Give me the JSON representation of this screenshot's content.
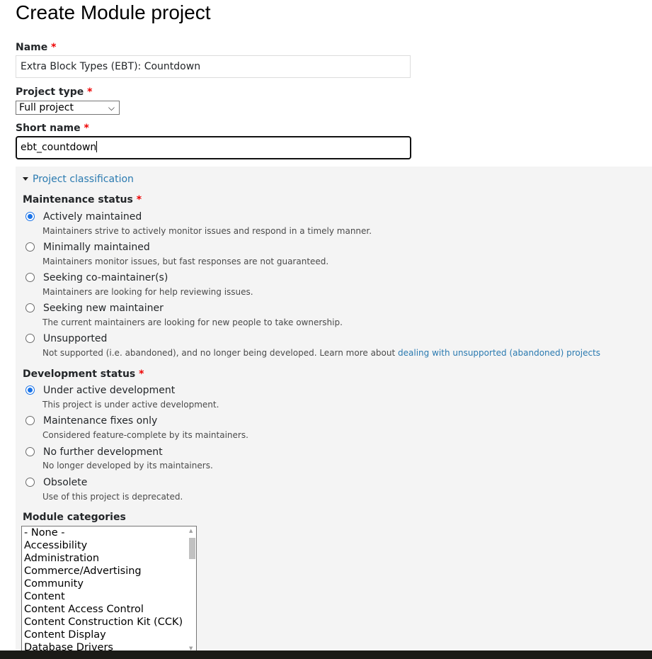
{
  "page": {
    "title": "Create Module project"
  },
  "form": {
    "name": {
      "label": "Name",
      "required_marker": "*",
      "value": "Extra Block Types (EBT): Countdown"
    },
    "project_type": {
      "label": "Project type",
      "required_marker": "*",
      "selected": "Full project"
    },
    "short_name": {
      "label": "Short name",
      "required_marker": "*",
      "value": "ebt_countdown"
    }
  },
  "classification": {
    "legend": "Project classification",
    "maintenance": {
      "label": "Maintenance status",
      "required_marker": "*",
      "options": [
        {
          "label": "Actively maintained",
          "desc": "Maintainers strive to actively monitor issues and respond in a timely manner.",
          "checked": true
        },
        {
          "label": "Minimally maintained",
          "desc": "Maintainers monitor issues, but fast responses are not guaranteed.",
          "checked": false
        },
        {
          "label": "Seeking co-maintainer(s)",
          "desc": "Maintainers are looking for help reviewing issues.",
          "checked": false
        },
        {
          "label": "Seeking new maintainer",
          "desc": "The current maintainers are looking for new people to take ownership.",
          "checked": false
        },
        {
          "label": "Unsupported",
          "desc": "Not supported (i.e. abandoned), and no longer being developed. Learn more about ",
          "link": "dealing with unsupported (abandoned) projects",
          "checked": false
        }
      ]
    },
    "development": {
      "label": "Development status",
      "required_marker": "*",
      "options": [
        {
          "label": "Under active development",
          "desc": "This project is under active development.",
          "checked": true
        },
        {
          "label": "Maintenance fixes only",
          "desc": "Considered feature-complete by its maintainers.",
          "checked": false
        },
        {
          "label": "No further development",
          "desc": "No longer developed by its maintainers.",
          "checked": false
        },
        {
          "label": "Obsolete",
          "desc": "Use of this project is deprecated.",
          "checked": false
        }
      ]
    },
    "categories": {
      "label": "Module categories",
      "options": [
        "- None -",
        "Accessibility",
        "Administration",
        "Commerce/Advertising",
        "Community",
        "Content",
        "Content Access Control",
        "Content Construction Kit (CCK)",
        "Content Display",
        "Database Drivers"
      ]
    }
  },
  "colors": {
    "link": "#2a7ab0",
    "required": "#e00000",
    "radio_checked": "#1a73e8",
    "panel_bg": "#f4f4f4"
  }
}
